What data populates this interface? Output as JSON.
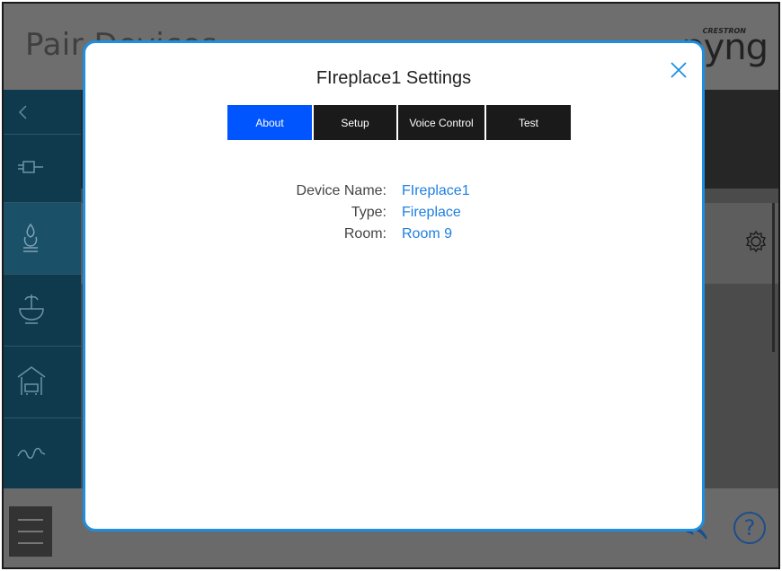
{
  "background": {
    "title": "Pair Devices",
    "logo_brand": "CRESTRON",
    "logo_word": "pyng",
    "help_label": "?"
  },
  "modal": {
    "title": "FIreplace1 Settings",
    "tabs": [
      {
        "label": "About",
        "active": true
      },
      {
        "label": "Setup",
        "active": false
      },
      {
        "label": "Voice Control",
        "active": false
      },
      {
        "label": "Test",
        "active": false
      }
    ],
    "fields": [
      {
        "label": "Device Name:",
        "value": "FIreplace1"
      },
      {
        "label": "Type:",
        "value": "Fireplace"
      },
      {
        "label": "Room:",
        "value": "Room 9"
      }
    ]
  },
  "colors": {
    "accent": "#1e8fe0",
    "active_tab": "#0055ff",
    "value_text": "#1e7fe0"
  }
}
